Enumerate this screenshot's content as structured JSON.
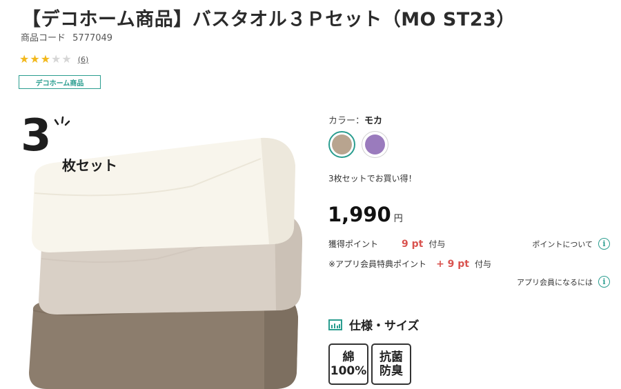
{
  "product": {
    "title": "【デコホーム商品】バスタオル３Ｐセット（MO ST23）",
    "code_label": "商品コード",
    "code_value": "5777049",
    "rating_value": 3,
    "rating_max": 5,
    "review_count": "(6)",
    "brand_tag": "デコホーム商品"
  },
  "image": {
    "badge_number": "3",
    "badge_text": "枚セット",
    "towel_colors": [
      "#f8f5ec",
      "#d9d0c6",
      "#8c7d6d"
    ]
  },
  "color": {
    "label": "カラー：",
    "selected": "モカ",
    "swatches": [
      {
        "name": "モカ",
        "hex": "#b8a48f",
        "selected": true
      },
      {
        "name": "パープル",
        "hex": "#9a7bbd",
        "selected": false
      }
    ]
  },
  "promo": "3枚セットでお買い得！",
  "price": {
    "value": "1,990",
    "unit": "円"
  },
  "points": {
    "earn_label": "獲得ポイント",
    "earn_value": "9 pt",
    "earn_suffix": "付与",
    "app_label": "※アプリ会員特典ポイント",
    "app_value": "+ 9 pt",
    "app_suffix": "付与",
    "about_link": "ポイントについて",
    "app_member_link": "アプリ会員になるには"
  },
  "spec": {
    "heading": "仕様・サイズ",
    "badges": [
      {
        "line1": "綿",
        "line2": "100%"
      },
      {
        "line1": "抗菌",
        "line2": "防臭"
      }
    ]
  },
  "colors": {
    "accent": "#2a9d8f",
    "points_red": "#d9534f",
    "star": "#f2b81c"
  }
}
